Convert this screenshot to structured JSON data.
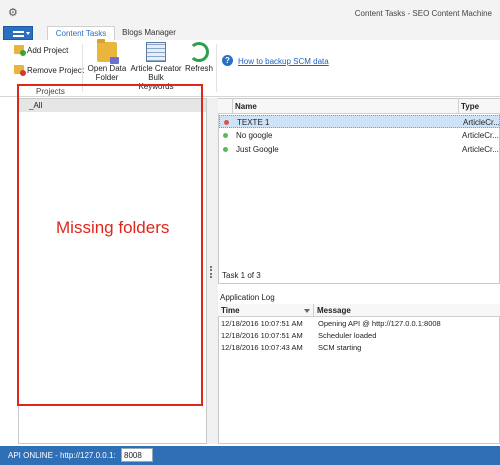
{
  "window": {
    "title": "Content Tasks - SEO Content Machine"
  },
  "ribbon": {
    "tabs": [
      {
        "label": "Content Tasks",
        "active": true
      },
      {
        "label": "Blogs Manager",
        "active": false
      }
    ],
    "add_project": "Add Project",
    "remove_project": "Remove Project",
    "group_projects": "Projects",
    "open_data_folder_line1": "Open Data",
    "open_data_folder_line2": "Folder",
    "article_creator_line1": "Article Creator",
    "article_creator_line2": "Bulk Keywords",
    "refresh": "Refresh",
    "help_glyph": "?",
    "backup_link": "How to backup SCM data"
  },
  "projects": {
    "items": [
      {
        "label": "_All"
      }
    ]
  },
  "annotation": {
    "text": "Missing folders"
  },
  "tasks": {
    "columns": {
      "name": "Name",
      "type": "Type"
    },
    "rows": [
      {
        "name": "TEXTE 1",
        "type": "ArticleCr...",
        "status_color": "#d9534f",
        "selected": true
      },
      {
        "name": "No google",
        "type": "ArticleCr...",
        "status_color": "#5cb85c",
        "selected": false
      },
      {
        "name": "Just Google",
        "type": "ArticleCr...",
        "status_color": "#5cb85c",
        "selected": false
      }
    ],
    "count_label": "Task 1 of 3"
  },
  "log": {
    "title": "Application Log",
    "columns": {
      "time": "Time",
      "message": "Message"
    },
    "rows": [
      {
        "time": "12/18/2016 10:07:51 AM",
        "message": "Opening API @ http://127.0.0.1:8008"
      },
      {
        "time": "12/18/2016 10:07:51 AM",
        "message": "Scheduler loaded"
      },
      {
        "time": "12/18/2016 10:07:43 AM",
        "message": "SCM starting"
      }
    ]
  },
  "status": {
    "text": "API ONLINE - http://127.0.0.1:",
    "port": "8008"
  },
  "colors": {
    "accent": "#2a6fc0",
    "status_bar": "#2f6fb5",
    "annotation": "#e0261b"
  }
}
